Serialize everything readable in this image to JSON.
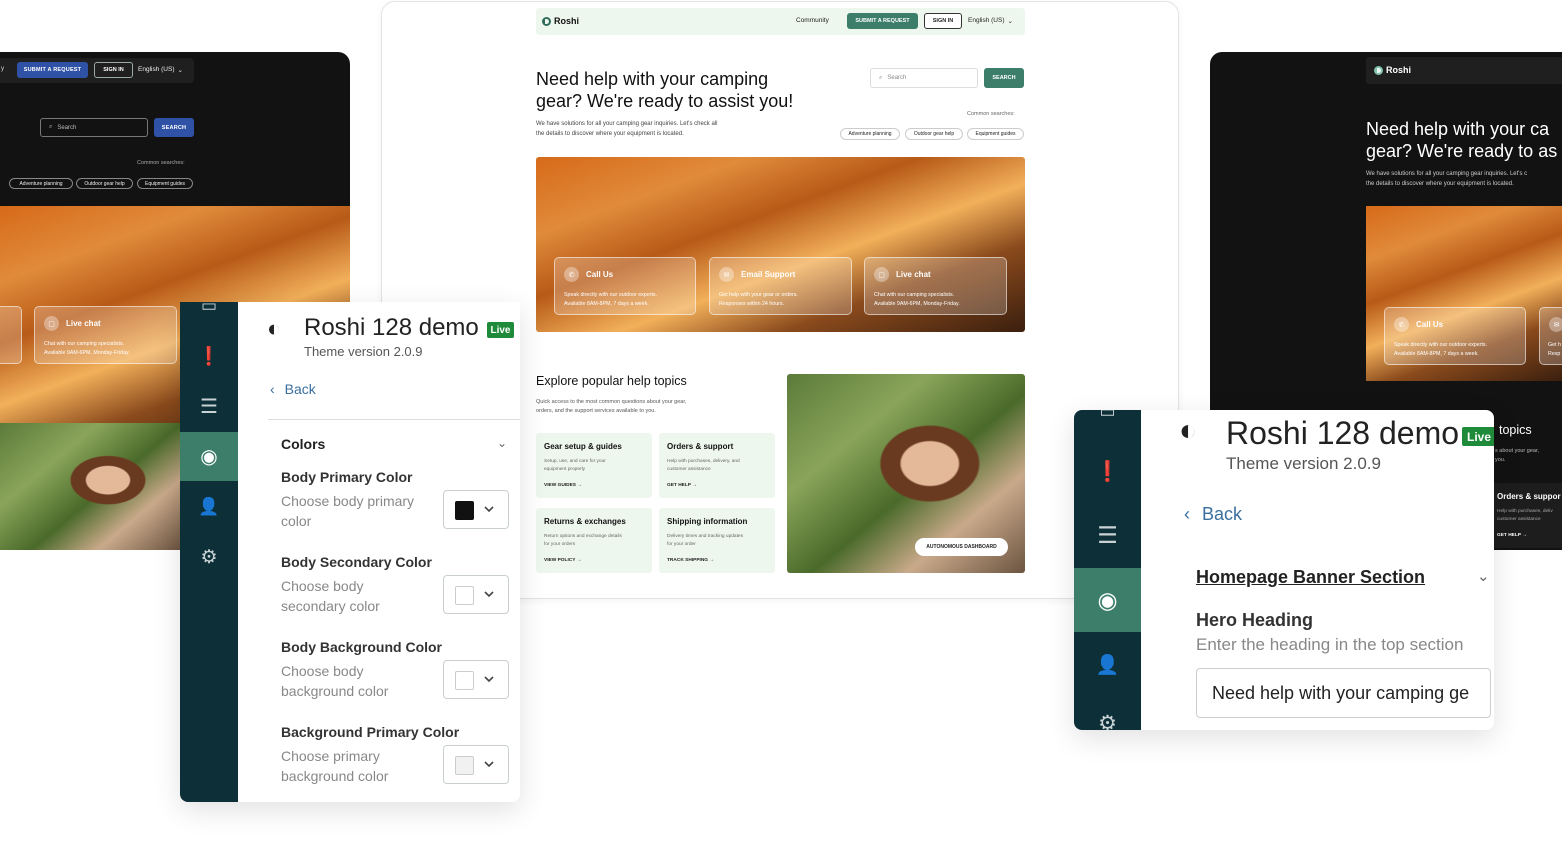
{
  "brand": "Roshi",
  "nav": {
    "community": "Community",
    "submit": "SUBMIT A REQUEST",
    "sign_in": "SIGN IN",
    "language": "English (US)",
    "left_cutoff": "y"
  },
  "hero": {
    "title_line1": "Need help with your camping",
    "title_line2": "gear? We're ready to assist you!",
    "sub_line1": "We have solutions for all your camping gear inquiries. Let's check all",
    "sub_line2": "the details to discover where your equipment is located.",
    "search_placeholder": "Search",
    "search_button": "SEARCH",
    "common_searches": "Common searches:",
    "chips": [
      "Adventure planning",
      "Outdoor gear help",
      "Equipment guides"
    ]
  },
  "contact_cards": [
    {
      "title": "Call Us",
      "icon": "phone-icon",
      "line1": "Speak directly with our outdoor experts.",
      "line2": "Available 8AM-8PM, 7 days a week."
    },
    {
      "title": "Email Support",
      "icon": "mail-icon",
      "line1": "Get help with your gear or orders.",
      "line2": "Responses within 24 hours."
    },
    {
      "title": "Live chat",
      "icon": "chat-icon",
      "line1": "Chat with our camping specialists.",
      "line2": "Available 9AM-6PM, Monday-Friday."
    }
  ],
  "right_preview": {
    "title_line1": "Need help with your ca",
    "title_line2": "gear? We're ready to as",
    "sub_line1": "We have solutions for all your camping gear inquiries. Let's c",
    "sub_line2": "the details to discover where your equipment is located.",
    "card_cut_title": "Call Us",
    "card_cut_line1": "Speak directly with our outdoor experts.",
    "card_cut_line2": "Available 8AM-8PM, 7 days a week.",
    "card_cut2_line1": "Get h",
    "card_cut2_line2": "Resp",
    "topics_word": "topics",
    "topics_sub_line1": "s about your gear,",
    "topics_sub_line2": "you.",
    "orders_title": "Orders & suppor",
    "orders_line1": "Help with purchases, deliv",
    "orders_line2": "customer assistance",
    "orders_link": "GET HELP →"
  },
  "topics": {
    "title": "Explore popular help topics",
    "sub_line1": "Quick access to the most common questions about your gear,",
    "sub_line2": "orders, and the support services available to you.",
    "badge": "AUTONOMOUS DASHBOARD",
    "cards": [
      {
        "title": "Gear setup & guides",
        "d1": "Setup, use, and care for your",
        "d2": "equipment properly",
        "link": "VIEW GUIDES →"
      },
      {
        "title": "Orders & support",
        "d1": "Help with purchases, delivery, and",
        "d2": "customer assistance",
        "link": "GET HELP →"
      },
      {
        "title": "Returns & exchanges",
        "d1": "Return options and exchange details",
        "d2": "for your orders",
        "link": "VIEW POLICY →"
      },
      {
        "title": "Shipping information",
        "d1": "Delivery times and tracking updates",
        "d2": "for your order",
        "link": "TRACK SHIPPING →"
      }
    ]
  },
  "panel_left": {
    "title": "Roshi 128 demo",
    "live": "Live",
    "version": "Theme version 2.0.9",
    "back": "Back",
    "section": "Colors",
    "fields": [
      {
        "label": "Body Primary Color",
        "hint1": "Choose body primary",
        "hint2": "color",
        "swatch": "#111111"
      },
      {
        "label": "Body Secondary Color",
        "hint1": "Choose body",
        "hint2": "secondary color",
        "swatch": "#ffffff"
      },
      {
        "label": "Body Background Color",
        "hint1": "Choose body",
        "hint2": "background color",
        "swatch": "#ffffff"
      },
      {
        "label": "Background Primary Color",
        "hint1": "Choose primary",
        "hint2": "background color",
        "swatch": "#f1f1f1"
      }
    ]
  },
  "panel_right": {
    "title": "Roshi 128 demo",
    "live": "Live",
    "version": "Theme version 2.0.9",
    "back": "Back",
    "section": "Homepage Banner Section",
    "field_label": "Hero Heading",
    "field_hint": "Enter the heading in the top section",
    "field_value": "Need help with your camping ge"
  },
  "colors": {
    "accent_green": "#3d7e6b",
    "rail": "#0d2f37",
    "dark_bg": "#121212",
    "blue_btn": "#3052a6",
    "live_badge": "#1f8a3a"
  }
}
